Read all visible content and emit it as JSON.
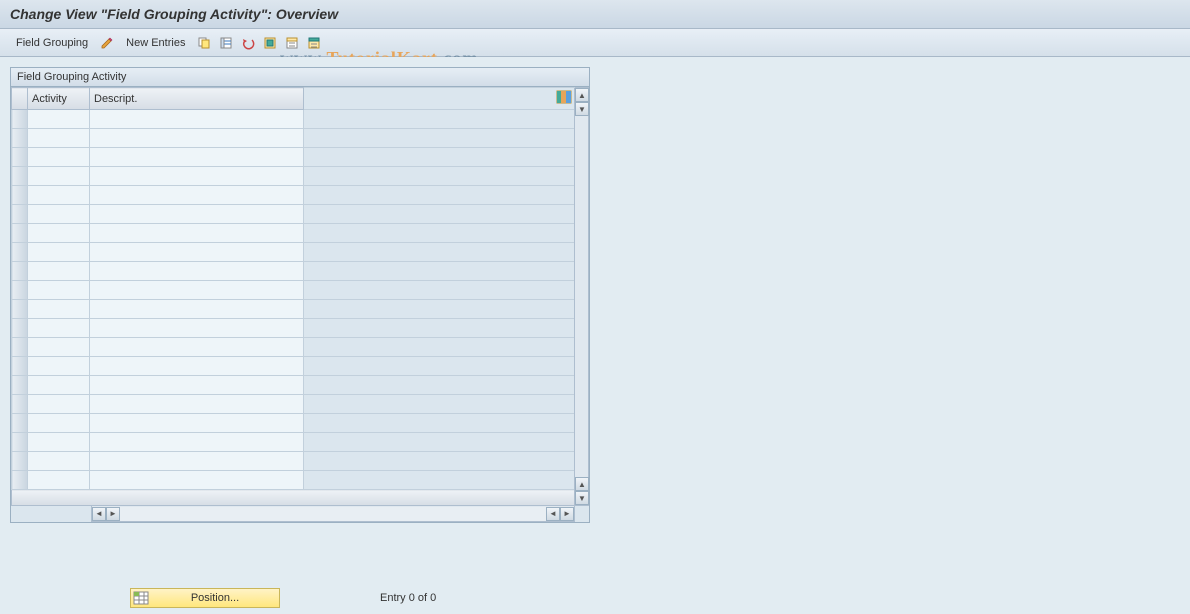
{
  "title": "Change View \"Field Grouping Activity\": Overview",
  "toolbar": {
    "field_grouping_label": "Field Grouping",
    "new_entries_label": "New Entries"
  },
  "table": {
    "title": "Field Grouping Activity",
    "columns": {
      "activity": "Activity",
      "description": "Descript."
    },
    "row_count": 20
  },
  "footer": {
    "position_label": "Position...",
    "entry_text": "Entry 0 of 0"
  },
  "watermark": {
    "part1": "www.",
    "part2": "TutorialKart",
    "part3": ".com"
  },
  "icons": {
    "pencil": "pencil-icon",
    "copy": "copy-icon",
    "select_all": "select-all-icon",
    "deselect": "deselect-icon",
    "delimit": "delimit-icon",
    "select_block": "select-block-icon",
    "deselect_block": "deselect-block-icon",
    "config": "config-icon",
    "grid": "grid-icon"
  }
}
